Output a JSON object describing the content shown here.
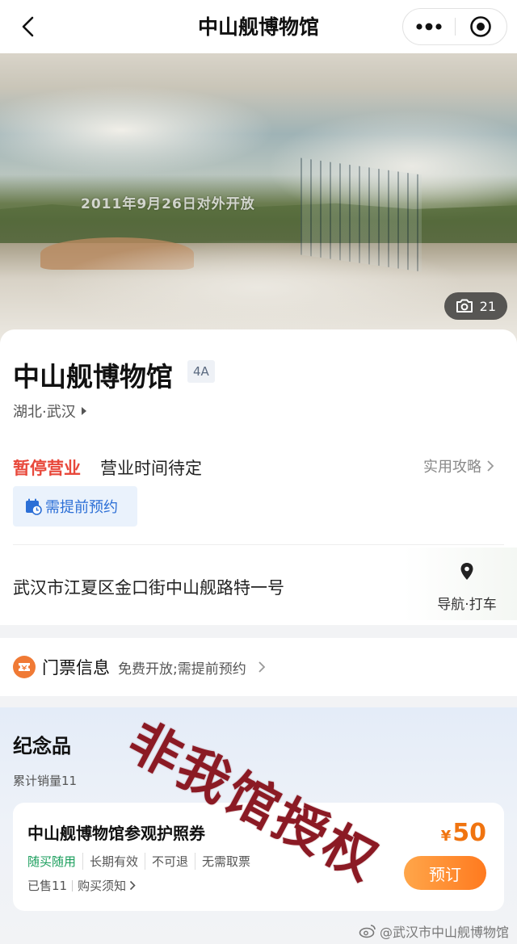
{
  "nav": {
    "title": "中山舰博物馆"
  },
  "hero": {
    "caption": "2011年9月26日对外开放",
    "photo_count": "21"
  },
  "info": {
    "name": "中山舰博物馆",
    "level": "4A",
    "region": "湖北·武汉",
    "status": "暂停营业",
    "hours": "营业时间待定",
    "guide_link": "实用攻略",
    "reservation_tag": "需提前预约",
    "address": "武汉市江夏区金口街中山舰路特一号",
    "nav_taxi": "导航·打车"
  },
  "ticket": {
    "label": "门票信息",
    "desc": "免费开放;需提前预约"
  },
  "souvenir": {
    "title": "纪念品",
    "total_sales": "累计销量11",
    "product": {
      "name": "中山舰博物馆参观护照券",
      "tags": [
        "随买随用",
        "长期有效",
        "不可退",
        "无需取票"
      ],
      "sold": "已售11",
      "notice": "购买须知",
      "currency": "¥",
      "price": "50",
      "book_label": "预订"
    }
  },
  "watermark": {
    "stamp": "非我馆授权",
    "weibo": "@武汉市中山舰博物馆"
  },
  "colors": {
    "status_red": "#e8483b",
    "link_blue": "#2c6fd6",
    "price_orange": "#f07410",
    "tag_green": "#1a9e5c"
  }
}
